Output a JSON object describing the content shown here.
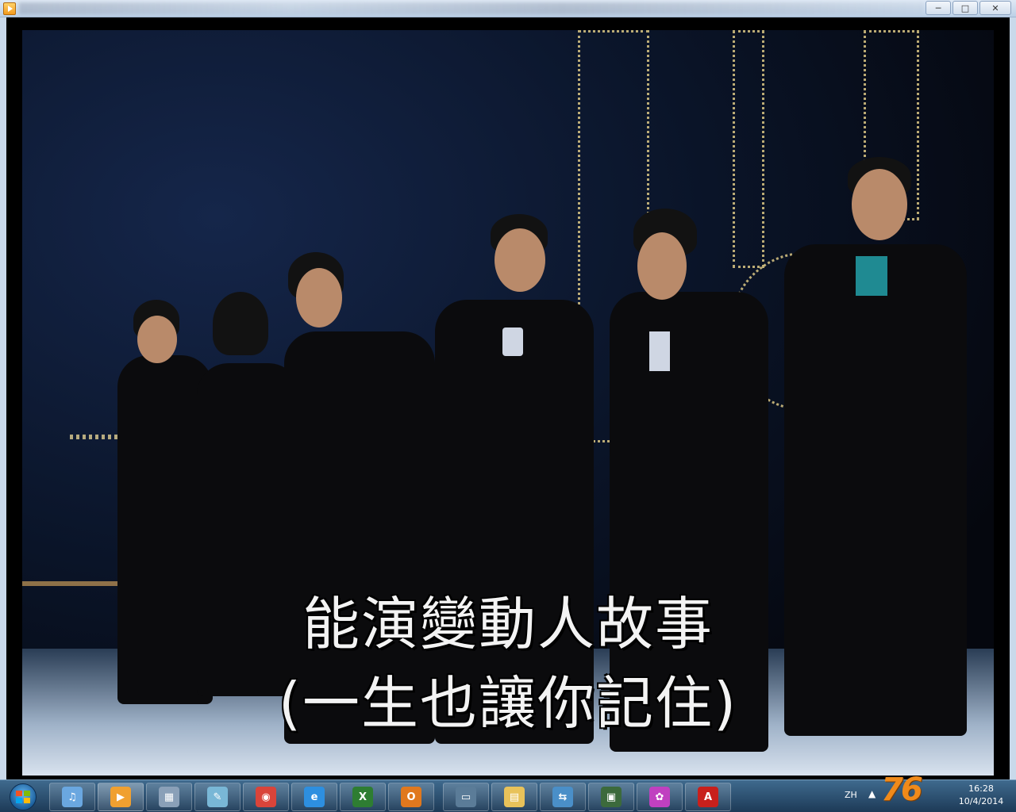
{
  "window": {
    "controls": {
      "minimize": "─",
      "maximize": "□",
      "close": "✕"
    }
  },
  "video": {
    "subtitle_line1": "能演變動人故事",
    "subtitle_line2": "(一生也讓你記住)"
  },
  "taskbar": {
    "start_icon": "windows-flag-icon",
    "buttons": [
      {
        "icon": "itunes-icon",
        "glyph": "♫",
        "color": "#6aa7e0"
      },
      {
        "icon": "media-player-icon",
        "glyph": "▶",
        "color": "#f0a030",
        "active": true
      },
      {
        "icon": "calculator-icon",
        "glyph": "▦",
        "color": "#8aa0b8"
      },
      {
        "icon": "notes-icon",
        "glyph": "✎",
        "color": "#79b7d6"
      },
      {
        "icon": "chrome-icon",
        "glyph": "◉",
        "color": "#d9443a"
      },
      {
        "icon": "internet-explorer-icon",
        "glyph": "e",
        "color": "#2d8fe0"
      },
      {
        "icon": "excel-icon",
        "glyph": "X",
        "color": "#2e7d32"
      },
      {
        "icon": "outlook-icon",
        "glyph": "O",
        "color": "#e0781e"
      },
      {
        "icon": "window-app-icon",
        "glyph": "▭",
        "color": "#5b7c98"
      },
      {
        "icon": "file-explorer-icon",
        "glyph": "▤",
        "color": "#e8c25a"
      },
      {
        "icon": "network-icon",
        "glyph": "⇆",
        "color": "#4a8fc8"
      },
      {
        "icon": "remote-desktop-icon",
        "glyph": "▣",
        "color": "#3c6a3c"
      },
      {
        "icon": "picasa-icon",
        "glyph": "✿",
        "color": "#c040c0"
      },
      {
        "icon": "acrobat-icon",
        "glyph": "A",
        "color": "#c8201c"
      }
    ],
    "language": "ZH",
    "tray_arrow": "▲",
    "watermark_logo": "76",
    "clock": {
      "time": "16:28",
      "date": "10/4/2014"
    }
  }
}
